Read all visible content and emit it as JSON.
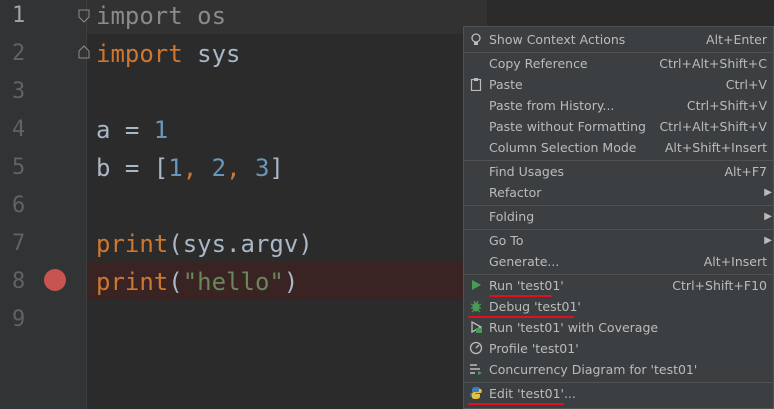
{
  "editor": {
    "line_numbers": [
      "1",
      "2",
      "3",
      "4",
      "5",
      "6",
      "7",
      "8",
      "9"
    ],
    "code": {
      "l1_kw": "import",
      "l1_rest": " os",
      "l2_kw": "import",
      "l2_rest": " sys",
      "l4_a": "a = ",
      "l4_num": "1",
      "l5_a": "b = [",
      "l5_n1": "1",
      "l5_c1": ", ",
      "l5_n2": "2",
      "l5_c2": ", ",
      "l5_n3": "3",
      "l5_end": "]",
      "l7_kw": "print",
      "l7_rest": "(sys.argv)",
      "l8_kw": "print",
      "l8_open": "(",
      "l8_str": "\"hello\"",
      "l8_close": ")"
    }
  },
  "context_menu": {
    "items": [
      {
        "label": "Show Context Actions",
        "shortcut": "Alt+Enter",
        "icon": "bulb-icon"
      },
      {
        "label": "Copy Reference",
        "shortcut": "Ctrl+Alt+Shift+C"
      },
      {
        "label": "Paste",
        "shortcut": "Ctrl+V",
        "icon": "clipboard-icon"
      },
      {
        "label": "Paste from History...",
        "shortcut": "Ctrl+Shift+V"
      },
      {
        "label": "Paste without Formatting",
        "shortcut": "Ctrl+Alt+Shift+V"
      },
      {
        "label": "Column Selection Mode",
        "shortcut": "Alt+Shift+Insert"
      },
      {
        "label": "Find Usages",
        "shortcut": "Alt+F7"
      },
      {
        "label": "Refactor",
        "submenu": true
      },
      {
        "label": "Folding",
        "submenu": true
      },
      {
        "label": "Go To",
        "submenu": true
      },
      {
        "label": "Generate...",
        "shortcut": "Alt+Insert"
      },
      {
        "label": "Run 'test01'",
        "shortcut": "Ctrl+Shift+F10",
        "icon": "run-icon"
      },
      {
        "label": "Debug 'test01'",
        "shortcut": "",
        "icon": "debug-icon"
      },
      {
        "label": "Run 'test01' with Coverage",
        "shortcut": "",
        "icon": "coverage-icon"
      },
      {
        "label": "Profile 'test01'",
        "shortcut": "",
        "icon": "profile-icon"
      },
      {
        "label": "Concurrency Diagram for 'test01'",
        "shortcut": "",
        "icon": "concurrency-icon"
      },
      {
        "label": "Edit 'test01'...",
        "shortcut": "",
        "icon": "python-icon"
      }
    ]
  },
  "colors": {
    "highlight_underline": "#e0101e",
    "breakpoint": "#c75450",
    "run_green": "#499c54"
  }
}
